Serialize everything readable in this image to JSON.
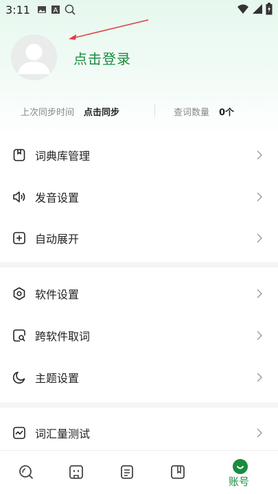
{
  "status_bar": {
    "time": "3:11"
  },
  "profile": {
    "login_text": "点击登录"
  },
  "stats": {
    "last_sync_label": "上次同步时间",
    "last_sync_value": "点击同步",
    "lookup_count_label": "查词数量",
    "lookup_count_value": "0个"
  },
  "menu": {
    "section1": [
      {
        "label": "词典库管理",
        "icon": "book-square-icon"
      },
      {
        "label": "发音设置",
        "icon": "speaker-icon"
      },
      {
        "label": "自动展开",
        "icon": "plus-square-icon"
      }
    ],
    "section2": [
      {
        "label": "软件设置",
        "icon": "hex-gear-icon"
      },
      {
        "label": "跨软件取词",
        "icon": "search-square-icon"
      },
      {
        "label": "主题设置",
        "icon": "moon-icon"
      }
    ],
    "section3": [
      {
        "label": "词汇量测试",
        "icon": "chart-square-icon"
      }
    ]
  },
  "bottom_nav": {
    "items": [
      {
        "icon": "search-icon"
      },
      {
        "icon": "card-icon"
      },
      {
        "icon": "document-icon"
      },
      {
        "icon": "bookmark-book-icon"
      }
    ],
    "account_label": "账号"
  },
  "colors": {
    "accent": "#1b8b3f",
    "gradient_top": "#e6f8ee"
  }
}
